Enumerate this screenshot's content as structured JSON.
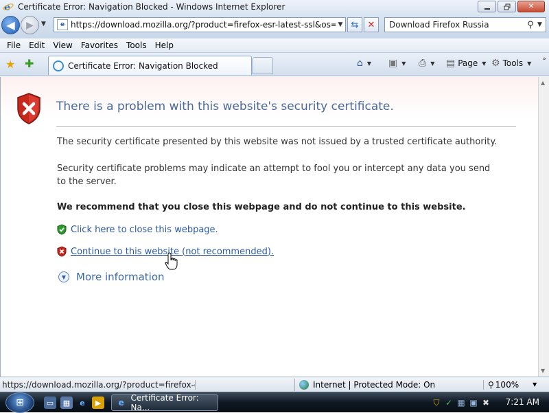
{
  "window": {
    "title": "Certificate Error: Navigation Blocked - Windows Internet Explorer"
  },
  "address_bar": {
    "url": "https://download.mozilla.org/?product=firefox-esr-latest-ssl&os=win&",
    "search_text": "Download Firefox Russia"
  },
  "menu": {
    "items": [
      "File",
      "Edit",
      "View",
      "Favorites",
      "Tools",
      "Help"
    ]
  },
  "tabs": [
    {
      "label": "Certificate Error: Navigation Blocked"
    }
  ],
  "command_bar": {
    "page_label": "Page",
    "tools_label": "Tools"
  },
  "content": {
    "heading": "There is a problem with this website's security certificate.",
    "paragraph_1": "The security certificate presented by this website was not issued by a trusted certificate authority.",
    "paragraph_2": "Security certificate problems may indicate an attempt to fool you or intercept any data you send to the server.",
    "recommendation": "We recommend that you close this webpage and do not continue to this website.",
    "close_link": "Click here to close this webpage.",
    "continue_link": "Continue to this website (not recommended).",
    "more_info": "More information"
  },
  "status_bar": {
    "url": "https://download.mozilla.org/?product=firefox-esr-latest",
    "zone": "Internet | Protected Mode: On",
    "zoom": "100%"
  },
  "taskbar": {
    "task_label": "Certificate Error: Na...",
    "clock": "7:21 AM"
  },
  "icons": {
    "shield_error": "shield-error-icon",
    "shield_ok": "shield-ok-icon",
    "ie": "ie-icon"
  },
  "colors": {
    "heading": "#4a6a9a",
    "link": "#2b5aa3",
    "error_red": "#c8281c",
    "ok_green": "#2e9a2e"
  }
}
